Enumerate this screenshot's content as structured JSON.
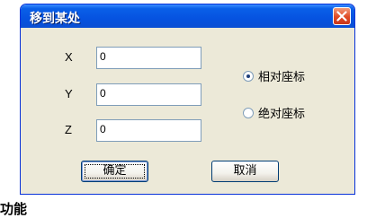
{
  "dialog": {
    "title": "移到某处",
    "close_icon": "close-icon",
    "fields": [
      {
        "label": "X",
        "value": "0"
      },
      {
        "label": "Y",
        "value": "0"
      },
      {
        "label": "Z",
        "value": "0"
      }
    ],
    "radio": {
      "relative_label": "相对座标",
      "absolute_label": "绝对座标",
      "selected": "relative"
    },
    "ok_label": "确定",
    "cancel_label": "取消"
  },
  "below_text": "功能"
}
